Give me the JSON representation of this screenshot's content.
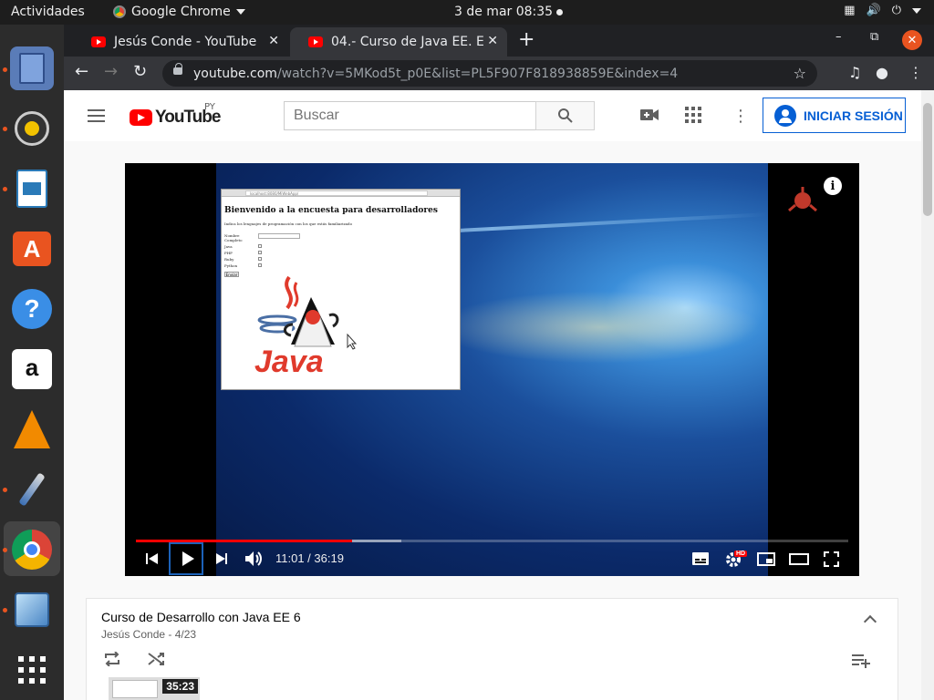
{
  "topbar": {
    "activities": "Actividades",
    "app_name": "Google Chrome",
    "clock": "3 de mar  08:35"
  },
  "dock": {
    "items": [
      "files-icon",
      "rhythmbox-icon",
      "libreoffice-writer-icon",
      "software-center-icon",
      "help-icon",
      "amazon-icon",
      "vlc-icon",
      "paint-icon",
      "chrome-icon",
      "virtualbox-icon",
      "show-apps-icon"
    ]
  },
  "tabs": [
    {
      "title": "Jesús Conde - YouTube"
    },
    {
      "title": "04.- Curso de Java EE. El p"
    }
  ],
  "address": {
    "host": "youtube.com",
    "path": "/watch?v=5MKod5t_p0E&list=PL5F907F818938859E&index=4"
  },
  "youtube": {
    "logo_text": "YouTube",
    "country_code": "PY",
    "search_placeholder": "Buscar",
    "signin_label": "INICIAR SESIÓN"
  },
  "video_frame": {
    "inner_url": "localhost:8080/MiWebApp/",
    "inner_heading": "Bienvenido a la encuesta para desarrolladores",
    "inner_subtext": "Indica los lenguajes de programación con los que estás familiarizado",
    "inner_name_label": "Nombre Completo",
    "inner_options": [
      "Java",
      "PHP",
      "Ruby",
      "Python"
    ],
    "inner_submit": "Enviar",
    "java_logo_text": "Java"
  },
  "player": {
    "time": "11:01 / 36:19",
    "played_fraction": 0.304,
    "loaded_fraction": 0.373,
    "hd_badge": "HD"
  },
  "playlist": {
    "title": "Curso de Desarrollo con Java EE 6",
    "subtitle": "Jesús Conde - 4/23",
    "first_duration": "35:23"
  }
}
